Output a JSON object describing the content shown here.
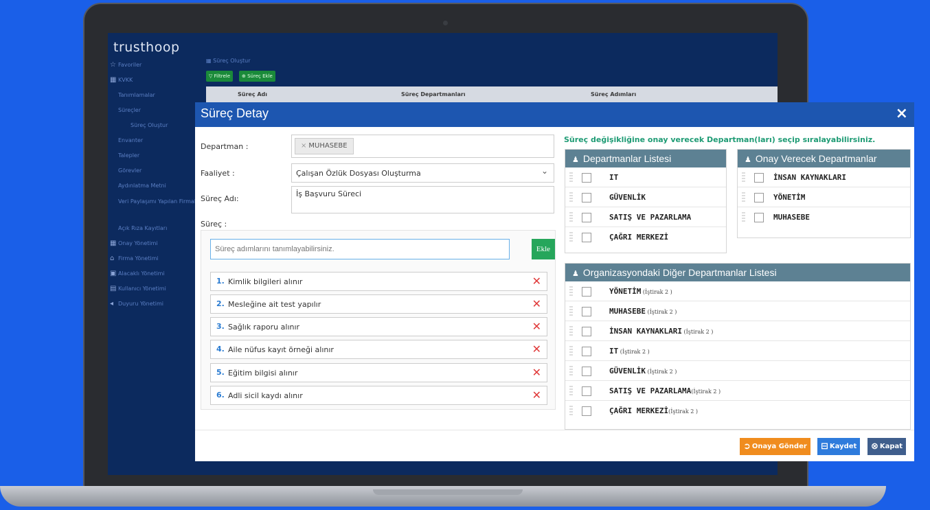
{
  "app": {
    "logo": "trusthoop"
  },
  "sidebar": {
    "items": [
      {
        "label": "Favoriler",
        "icon": "star-icon"
      },
      {
        "label": "KVKK",
        "icon": "grid-icon"
      },
      {
        "label": "Tanımlamalar"
      },
      {
        "label": "Süreçler"
      },
      {
        "label": "Süreç Oluştur"
      },
      {
        "label": "Envanter"
      },
      {
        "label": "Talepler"
      },
      {
        "label": "Görevler"
      },
      {
        "label": "Aydınlatma Metni"
      },
      {
        "label": "Veri Paylaşımı Yapılan Firmalar"
      },
      {
        "label": "Açık Rıza Kayıtları"
      },
      {
        "label": "Onay Yönetimi",
        "icon": "grid-icon"
      },
      {
        "label": "Firma Yönetimi",
        "icon": "building-icon"
      },
      {
        "label": "Alacaklı Yönetimi",
        "icon": "box-icon"
      },
      {
        "label": "Kullanıcı Yönetimi",
        "icon": "user-icon"
      },
      {
        "label": "Duyuru Yönetimi",
        "icon": "megaphone-icon"
      }
    ]
  },
  "background_page": {
    "breadcrumb": "Süreç Oluştur",
    "filter_label": "Filtrele",
    "add_label": "Süreç Ekle",
    "columns": [
      "Süreç Adı",
      "Süreç Departmanları",
      "Süreç Adımları"
    ]
  },
  "modal": {
    "title": "Süreç Detay",
    "close": "×",
    "department_label": "Departman :",
    "department_tag": "MUHASEBE",
    "activity_label": "Faaliyet :",
    "activity_value": "Çalışan Özlük Dosyası Oluşturma",
    "process_name_label": "Süreç Adı:",
    "process_name_value": "İş Başvuru Süreci",
    "process_label": "Süreç :",
    "step_placeholder": "Süreç adımlarını tanımlayabilirsiniz.",
    "add_button": "Ekle",
    "steps": [
      {
        "num": "1.",
        "text": "Kimlik bilgileri alınır"
      },
      {
        "num": "2.",
        "text": "Mesleğine ait test yapılır"
      },
      {
        "num": "3.",
        "text": "Sağlık raporu alınır"
      },
      {
        "num": "4.",
        "text": "Aile nüfus kayıt örneği alınır"
      },
      {
        "num": "5.",
        "text": "Eğitim bilgisi alınır"
      },
      {
        "num": "6.",
        "text": "Adli sicil kaydı alınır"
      }
    ],
    "delete_glyph": "✕",
    "hint": "Süreç değişikliğine onay verecek Departman(ları) seçip sıralayabilirsiniz.",
    "departments_panel": {
      "title": "Departmanlar Listesi",
      "items": [
        "IT",
        "GÜVENLİK",
        "SATIŞ VE PAZARLAMA",
        "ÇAĞRI MERKEZİ"
      ]
    },
    "approvers_panel": {
      "title": "Onay Verecek Departmanlar",
      "items": [
        "İNSAN KAYNAKLARI",
        "YÖNETİM",
        "MUHASEBE"
      ]
    },
    "other_panel": {
      "title": "Organizasyondaki Diğer Departmanlar Listesi",
      "items": [
        {
          "name": "YÖNETİM",
          "sub": " (İştirak 2 )"
        },
        {
          "name": "MUHASEBE",
          "sub": " (İştirak 2 )"
        },
        {
          "name": "İNSAN KAYNAKLARI",
          "sub": " (İştirak 2 )"
        },
        {
          "name": "IT",
          "sub": " (İştirak 2 )"
        },
        {
          "name": "GÜVENLİK",
          "sub": " (İştirak 2 )"
        },
        {
          "name": "SATIŞ VE PAZARLAMA",
          "sub": "(İştirak 2 )"
        },
        {
          "name": "ÇAĞRI MERKEZİ",
          "sub": "(İştirak 2 )"
        }
      ]
    },
    "footer": {
      "send_label": "Onaya Gönder",
      "save_label": "Kaydet",
      "close_label": "Kapat"
    },
    "colors": {
      "header": "#1d56b0",
      "send": "#f08c1e",
      "save": "#2e7bdc",
      "close": "#3f5e8c",
      "panel_head": "#5d8193"
    }
  }
}
